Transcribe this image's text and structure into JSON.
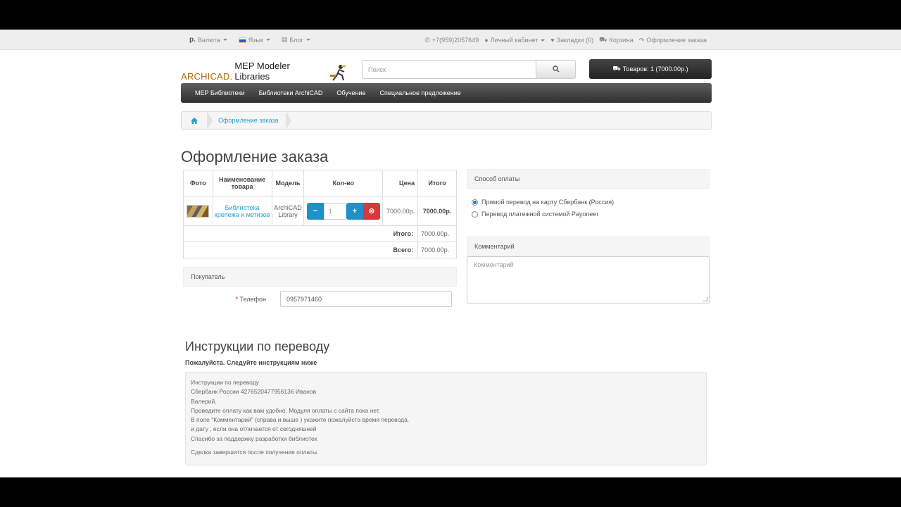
{
  "topbar": {
    "currency_symbol": "р.",
    "currency_label": "Валюта",
    "language_label": "Язык",
    "blog_label": "Блог",
    "phone": "+7(959)2057649",
    "account_label": "Личный кабинет",
    "wishlist_label": "Закладки (0)",
    "cart_label": "Корзина",
    "checkout_label": "Оформление заказа"
  },
  "header": {
    "logo_part1": "ARCHICAD.",
    "logo_part2": "MEP Modeler Libraries",
    "search_placeholder": "Поиск",
    "cart_button": "Товаров: 1 (7000.00р.)"
  },
  "menu": [
    "MEP Библиотеки",
    "Библиотеки ArchiCAD",
    "Обучение",
    "Специальное предложение"
  ],
  "breadcrumb": {
    "current": "Оформление заказа"
  },
  "page_title": "Оформление заказа",
  "cart_table": {
    "headers": [
      "Фото",
      "Наименование товара",
      "Модель",
      "Кол-во",
      "Цена",
      "Итого"
    ],
    "row": {
      "name": "Библиотека крепежа и метизов",
      "model": "ArchiCAD Library",
      "quantity": "1",
      "price": "7000.00р.",
      "total": "7000.00р."
    },
    "subtotal_label": "Итого:",
    "subtotal_value": "7000.00р.",
    "grand_label": "Всего:",
    "grand_value": "7000.00р."
  },
  "customer": {
    "heading": "Покупатель",
    "phone_label": "Телефон",
    "phone_value": "0957971460"
  },
  "payment": {
    "heading": "Способ оплаты",
    "options": [
      "Прямой перевод на карту Сбербанк (Россия)",
      "Перевод платежной системой Payoneer"
    ],
    "selected_index": 0
  },
  "comment": {
    "heading": "Комментарий",
    "placeholder": "Комментарий"
  },
  "instructions": {
    "title": "Инструкции по переводу",
    "subtitle": "Пожалуйста. Следуйте инструкциям ниже",
    "lines": [
      "Инструкции по переводу",
      "Сбербанк России 4276520477956136 Иванов",
      "Валерий.",
      "Проведите оплату как вам удобно. Модуля оплаты с сайта пока нет.",
      "В поле \"Комментарий\" (справа и выше ) укажите пожалуйста время перевода.",
      "и дату , если она отличается от сегодняшней",
      "Спасибо за поддержку разработки библиотек"
    ],
    "final_line": "Сделка завершится после получения оплаты."
  }
}
